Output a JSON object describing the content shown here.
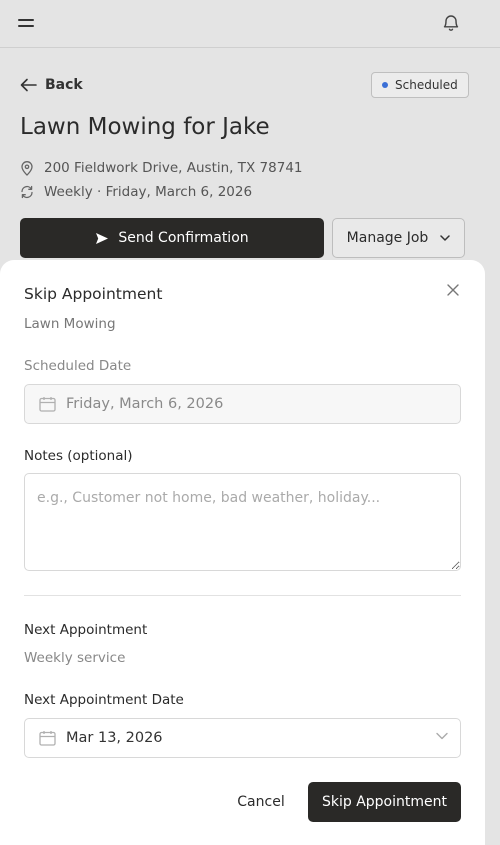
{
  "header": {
    "menu_icon": "hamburger-menu-icon",
    "notifications_icon": "bell-icon"
  },
  "job": {
    "back_label": "Back",
    "status": "Scheduled",
    "status_color": "#3b6fd6",
    "title": "Lawn Mowing for Jake",
    "address": "200 Fieldwork Drive, Austin, TX 78741",
    "schedule": "Weekly · Friday, March 6, 2026",
    "send_confirmation_label": "Send Confirmation",
    "manage_job_label": "Manage Job"
  },
  "modal": {
    "title": "Skip Appointment",
    "subtitle": "Lawn Mowing",
    "scheduled_date_label": "Scheduled Date",
    "scheduled_date_value": "Friday, March 6, 2026",
    "notes_label": "Notes (optional)",
    "notes_placeholder": "e.g., Customer not home, bad weather, holiday...",
    "notes_value": "",
    "next_appointment_heading": "Next Appointment",
    "next_appointment_sub": "Weekly service",
    "next_date_label": "Next Appointment Date",
    "next_date_value": "Mar 13, 2026",
    "cancel_label": "Cancel",
    "submit_label": "Skip Appointment"
  },
  "colors": {
    "primary_button": "#2a2927",
    "backdrop": "#e4e4e4",
    "sheet": "#ffffff"
  }
}
